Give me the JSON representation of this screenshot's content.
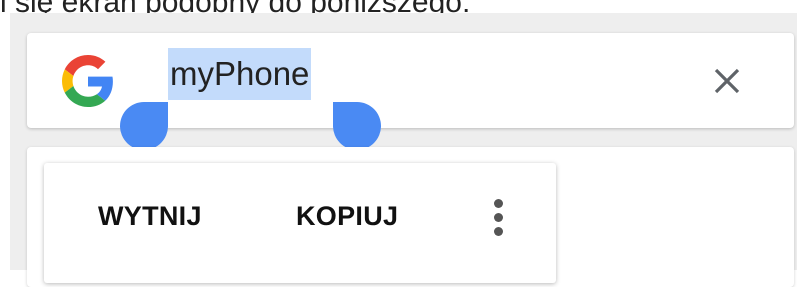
{
  "caption": "i się ekran podobny do poniższego:",
  "search": {
    "query": "myPhone",
    "logo_icon": "google-g-icon",
    "close_icon": "close-icon"
  },
  "selection": {
    "highlight_color": "#c3dbfb",
    "handle_color": "#4a8af3"
  },
  "context_menu": {
    "cut_label": "WYTNIJ",
    "copy_label": "KOPIUJ",
    "more_icon": "more-vert-icon"
  }
}
